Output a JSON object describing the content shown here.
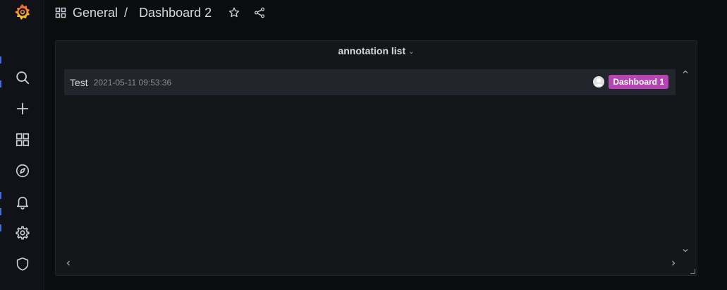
{
  "breadcrumb": {
    "folder": "General",
    "separator": "/",
    "dashboard": "Dashboard 2"
  },
  "icons": {
    "logo": "grafana-logo-icon",
    "search": "search-icon",
    "create": "plus-icon",
    "dashboards": "dashboards-grid-icon",
    "explore": "compass-icon",
    "alerting": "bell-icon",
    "configuration": "gear-icon",
    "server_admin": "shield-icon",
    "star": "star-icon",
    "share": "share-icon"
  },
  "panel": {
    "title": "annotation list",
    "title_chevron": "⌄",
    "annotations": [
      {
        "text": "Test",
        "time": "2021-05-11 09:53:36",
        "tag": "Dashboard 1"
      }
    ]
  },
  "colors": {
    "background": "#0b0c0e",
    "sidebar": "#111217",
    "panel": "#141619",
    "row": "#22252b",
    "tag": "#b545b3",
    "accent": "#3d71d9"
  }
}
